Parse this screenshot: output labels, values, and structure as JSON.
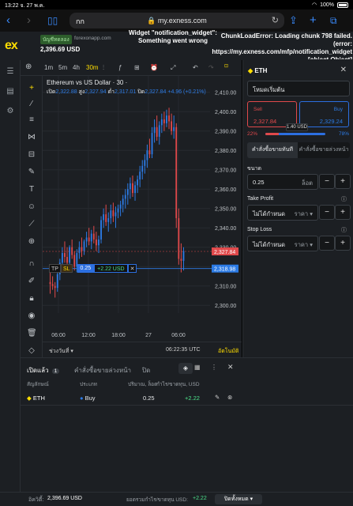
{
  "status": {
    "time": "13:22",
    "date": "จ. 27 พ.ค.",
    "battery": "100%"
  },
  "browser": {
    "aa": "กก",
    "url": "my.exness.com",
    "back": "‹",
    "forward": "›"
  },
  "header": {
    "logo": "ex",
    "account_badge": "บัญชีทดลอง",
    "account_site": "forexonapp.com",
    "balance": "2,396.69 USD",
    "widget_error": "Widget \"notification_widget\": Something went wrong",
    "chunk_error": "ChunkLoadError: Loading chunk 798 failed. (error: https://my.exness.com/mfp/notification_widget [object Object]"
  },
  "chart": {
    "timeframes": [
      "1m",
      "5m",
      "4h",
      "30m"
    ],
    "active_timeframe": "30m",
    "symbol_title": "Ethereum vs US Dollar · 30 ·",
    "ohlc": {
      "o_label": "เปิด",
      "o": "2,322.88",
      "h_label": "สูง",
      "h": "2,327.94",
      "l_label": "ต่ำ",
      "l": "2,317.01",
      "c_label": "ปิด",
      "c": "2,327.84",
      "change": "+4.96 (+0.21%)"
    },
    "price_labels": [
      "2,410.00",
      "2,400.00",
      "2,390.00",
      "2,380.00",
      "2,370.00",
      "2,360.00",
      "2,350.00",
      "2,340.00",
      "2,330.00",
      "2,320.00",
      "2,310.00",
      "2,300.00"
    ],
    "time_labels": [
      "06:00",
      "12:00",
      "18:00",
      "27",
      "06:00"
    ],
    "current_price": "2,327.84",
    "position_price": "2,318.98",
    "position_line": {
      "tp": "TP",
      "sl": "SL",
      "volume": "0.25",
      "pnl": "+2.22 USD",
      "close": "✕"
    },
    "range_label": "ช่วงวันที่",
    "clock": "06:22:35 UTC",
    "auto_label": "อัตโนมัติ",
    "candles": [
      [
        2312,
        2318,
        2306,
        2311
      ],
      [
        2311,
        2315,
        2308,
        2310
      ],
      [
        2310,
        2312,
        2304,
        2309
      ],
      [
        2309,
        2318,
        2307,
        2316
      ],
      [
        2316,
        2324,
        2313,
        2322
      ],
      [
        2322,
        2330,
        2320,
        2327
      ],
      [
        2327,
        2333,
        2322,
        2325
      ],
      [
        2325,
        2330,
        2319,
        2322
      ],
      [
        2322,
        2331,
        2320,
        2330
      ],
      [
        2330,
        2334,
        2324,
        2326
      ],
      [
        2326,
        2328,
        2318,
        2320
      ],
      [
        2320,
        2329,
        2317,
        2327
      ],
      [
        2327,
        2333,
        2324,
        2330
      ],
      [
        2330,
        2335,
        2325,
        2328
      ],
      [
        2328,
        2334,
        2326,
        2333
      ],
      [
        2333,
        2338,
        2330,
        2335
      ],
      [
        2335,
        2340,
        2331,
        2333
      ],
      [
        2333,
        2339,
        2329,
        2337
      ],
      [
        2337,
        2341,
        2332,
        2334
      ],
      [
        2334,
        2338,
        2328,
        2331
      ],
      [
        2331,
        2336,
        2327,
        2334
      ],
      [
        2334,
        2346,
        2332,
        2344
      ],
      [
        2344,
        2350,
        2340,
        2347
      ],
      [
        2347,
        2352,
        2341,
        2343
      ],
      [
        2343,
        2348,
        2338,
        2345
      ],
      [
        2345,
        2352,
        2342,
        2349
      ],
      [
        2349,
        2353,
        2343,
        2346
      ],
      [
        2346,
        2351,
        2340,
        2348
      ],
      [
        2348,
        2352,
        2345,
        2350
      ],
      [
        2350,
        2354,
        2346,
        2352
      ],
      [
        2352,
        2357,
        2348,
        2355
      ],
      [
        2355,
        2360,
        2350,
        2357
      ],
      [
        2357,
        2363,
        2352,
        2360
      ],
      [
        2360,
        2366,
        2355,
        2363
      ],
      [
        2363,
        2367,
        2356,
        2358
      ],
      [
        2358,
        2364,
        2354,
        2362
      ],
      [
        2362,
        2367,
        2358,
        2365
      ],
      [
        2365,
        2372,
        2361,
        2369
      ],
      [
        2369,
        2375,
        2365,
        2372
      ],
      [
        2372,
        2378,
        2368,
        2375
      ],
      [
        2375,
        2383,
        2371,
        2380
      ],
      [
        2380,
        2386,
        2376,
        2378
      ],
      [
        2378,
        2392,
        2376,
        2389
      ],
      [
        2389,
        2396,
        2384,
        2392
      ],
      [
        2392,
        2398,
        2385,
        2387
      ],
      [
        2387,
        2395,
        2383,
        2393
      ],
      [
        2393,
        2399,
        2389,
        2396
      ],
      [
        2396,
        2400,
        2390,
        2394
      ],
      [
        2394,
        2401,
        2392,
        2398
      ],
      [
        2398,
        2402,
        2391,
        2395
      ],
      [
        2395,
        2399,
        2388,
        2390
      ],
      [
        2390,
        2398,
        2386,
        2392
      ],
      [
        2392,
        2394,
        2340,
        2345
      ],
      [
        2345,
        2350,
        2321,
        2324
      ],
      [
        2324,
        2332,
        2317,
        2323
      ],
      [
        2323,
        2330,
        2318,
        2328
      ]
    ]
  },
  "order_panel": {
    "symbol": "ETH",
    "mode": "โหมดเริ่มต้น",
    "sell_label": "Sell",
    "sell_price": "2,327.84",
    "buy_label": "Buy",
    "buy_price": "2,329.24",
    "spread": "1.40 USD",
    "sell_pct": "22%",
    "buy_pct": "78%",
    "sell_fraction": 0.22,
    "tabs": [
      "คำสั่งซื้อขายทันที",
      "คำสั่งซื้อขายล่วงหน้า"
    ],
    "volume_label": "ขนาด",
    "volume": "0.25",
    "volume_unit": "ล็อต",
    "tp_label": "Take Profit",
    "tp_value": "ไม่ได้กำหนด",
    "tp_unit": "ราคา",
    "sl_label": "Stop Loss",
    "sl_value": "ไม่ได้กำหนด",
    "sl_unit": "ราคา"
  },
  "positions": {
    "tabs": [
      "เปิดแล้ว",
      "คำสั่งซื้อขายล่วงหน้า",
      "ปิด"
    ],
    "open_count": "1",
    "columns": [
      "สัญลักษณ์",
      "ประเภท",
      "ปริมาณ, ล็อต",
      "กำไร/ขาดทุน, USD"
    ],
    "rows": [
      {
        "symbol": "ETH",
        "type": "Buy",
        "volume": "0.25",
        "pnl": "+2.22"
      }
    ]
  },
  "footer": {
    "equity_label": "อิควิตี้:",
    "equity": "2,396.69 USD",
    "total_pnl_label": "ยอดรวมกำไร/ขาดทุน USD:",
    "total_pnl": "+2.22",
    "close_all": "ปิดทั้งหมด"
  },
  "colors": {
    "up": "#2c7be5",
    "down": "#e0494b",
    "accent": "#ffde02",
    "bg": "#1c1f23"
  }
}
